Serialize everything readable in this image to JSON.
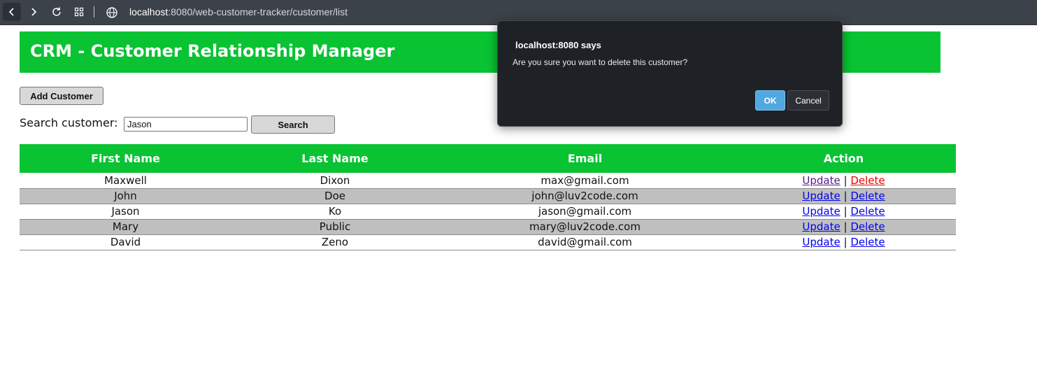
{
  "browser": {
    "url_host": "localhost",
    "url_rest": ":8080/web-customer-tracker/customer/list",
    "icons": [
      "back-icon",
      "forward-icon",
      "reload-icon",
      "tab-grid-icon",
      "globe-icon"
    ]
  },
  "header": {
    "title": "CRM - Customer Relationship Manager"
  },
  "toolbar": {
    "add_label": "Add Customer",
    "search_label": "Search customer:",
    "search_value": "Jason",
    "search_button": "Search"
  },
  "table": {
    "headers": [
      "First Name",
      "Last Name",
      "Email",
      "Action"
    ],
    "update_label": "Update",
    "delete_label": "Delete",
    "separator": "|",
    "rows": [
      {
        "first": "Maxwell",
        "last": "Dixon",
        "email": "max@gmail.com"
      },
      {
        "first": "John",
        "last": "Doe",
        "email": "john@luv2code.com"
      },
      {
        "first": "Jason",
        "last": "Ko",
        "email": "jason@gmail.com"
      },
      {
        "first": "Mary",
        "last": "Public",
        "email": "mary@luv2code.com"
      },
      {
        "first": "David",
        "last": "Zeno",
        "email": "david@gmail.com"
      }
    ]
  },
  "dialog": {
    "title": "localhost:8080 says",
    "message": "Are you sure you want to delete this customer?",
    "ok_label": "OK",
    "cancel_label": "Cancel"
  },
  "colors": {
    "brand_green": "#09c332",
    "row_alt": "#bfbfbf",
    "dialog_bg": "#1e2126",
    "ok_button": "#4fa8e0"
  }
}
